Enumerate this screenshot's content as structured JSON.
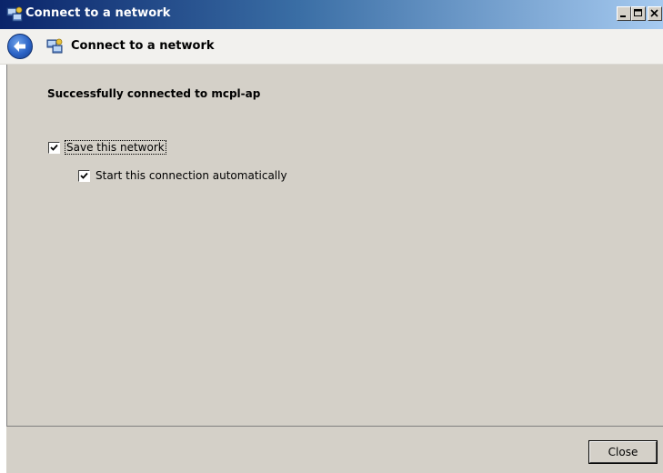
{
  "window": {
    "title": "Connect to a network",
    "title_icon": "network-connect-icon",
    "controls": {
      "minimize_icon": "minimize-icon",
      "maximize_icon": "maximize-icon",
      "close_icon": "close-icon"
    },
    "colors": {
      "titlebar_start": "#0a246a",
      "titlebar_end": "#a6caf0",
      "dialog_bg": "#d4d0c8"
    }
  },
  "nav": {
    "back_icon": "back-arrow-icon",
    "page_icon": "network-connect-icon",
    "title": "Connect to a network"
  },
  "main": {
    "status_message": "Successfully connected to mcpl-ap",
    "options": [
      {
        "label": "Save this network",
        "checked": true
      },
      {
        "label": "Start this connection automatically",
        "checked": true
      }
    ]
  },
  "footer": {
    "close_label": "Close"
  }
}
